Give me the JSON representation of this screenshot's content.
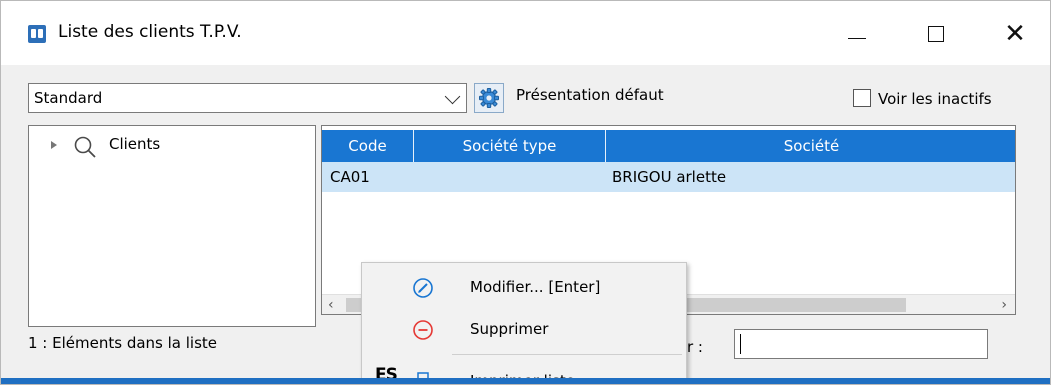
{
  "window": {
    "title": "Liste des clients T.P.V.",
    "controls": {
      "minimize_icon": "minimize-icon",
      "maximize_icon": "maximize-icon",
      "close_glyph": "✕"
    }
  },
  "toolbar": {
    "view_combo": {
      "selected": "Standard"
    },
    "presentation_label": "Présentation défaut",
    "show_inactive": {
      "label": "Voir les inactifs",
      "checked": false
    }
  },
  "tree": {
    "items": [
      {
        "label": "Clients",
        "icon": "search-icon"
      }
    ]
  },
  "grid": {
    "columns": [
      "Code",
      "Société type",
      "Société"
    ],
    "rows": [
      {
        "code": "CA01",
        "type": "",
        "societe": "BRIGOU arlette"
      }
    ],
    "header_color": "#1976d2",
    "selected_row_color": "#cce4f7"
  },
  "footer": {
    "count_text": "1 : Eléments dans la liste",
    "search_label": "r :",
    "search_value": ""
  },
  "context_menu": {
    "items": [
      {
        "label": "Modifier... [Enter]",
        "icon": "edit-icon"
      },
      {
        "label": "Supprimer",
        "icon": "delete-icon"
      },
      {
        "label": "Imprimer liste...",
        "icon": "print-icon"
      }
    ],
    "side_glyph": "ES"
  },
  "colors": {
    "accent": "#1976d2",
    "bottom_bar": "#1f6fc2"
  }
}
